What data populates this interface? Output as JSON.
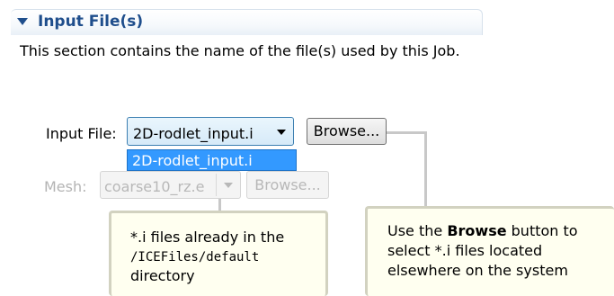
{
  "section": {
    "title": "Input File(s)",
    "description": "This section contains the name of the file(s) used by this Job."
  },
  "input_file": {
    "label": "Input File:",
    "selected_value": "2D-rodlet_input.i",
    "browse_label": "Browse...",
    "dropdown_options": [
      "2D-rodlet_input.i"
    ]
  },
  "mesh": {
    "label": "Mesh:",
    "selected_value": "coarse10_rz.e",
    "browse_label": "Browse..."
  },
  "callouts": {
    "left": {
      "line1": "*.i files already in the",
      "line2": "/ICEFiles/default",
      "line3": "directory"
    },
    "right": {
      "line1_prefix": "Use the ",
      "line1_bold": "Browse",
      "line1_suffix": " button to",
      "line2": "select *.i files located",
      "line3": "elsewhere on the system"
    }
  },
  "colors": {
    "accent": "#1f4e8c",
    "selection": "#3399ff",
    "callout_bg": "#fffff0"
  }
}
